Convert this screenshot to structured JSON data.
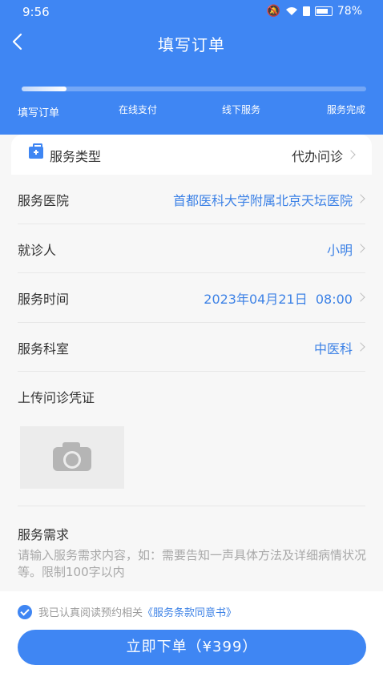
{
  "status_bar": {
    "time": "9:56",
    "battery": "78%"
  },
  "nav": {
    "title": "填写订单"
  },
  "progress": {
    "current_step": 1,
    "steps": [
      "填写订单",
      "在线支付",
      "线下服务",
      "服务完成"
    ]
  },
  "service_type": {
    "label": "服务类型",
    "value": "代办问诊"
  },
  "rows": [
    {
      "label": "服务医院",
      "value": "首都医科大学附属北京天坛医院"
    },
    {
      "label": "就诊人",
      "value": "小明"
    },
    {
      "label": "服务时间",
      "value": "2023年04月21日  08:00"
    },
    {
      "label": "服务科室",
      "value": "中医科"
    }
  ],
  "upload": {
    "title": "上传问诊凭证"
  },
  "demand": {
    "title": "服务需求",
    "placeholder": "请输入服务需求内容，如：需要告知一声具体方法及详细病情状况等。限制100字以内"
  },
  "agreement": {
    "text": "我已认真阅读预约相关",
    "link": "《服务条款同意书》"
  },
  "submit": {
    "label": "立即下单（¥399）"
  },
  "colors": {
    "primary": "#3f86f3",
    "link": "#3d82e6"
  }
}
